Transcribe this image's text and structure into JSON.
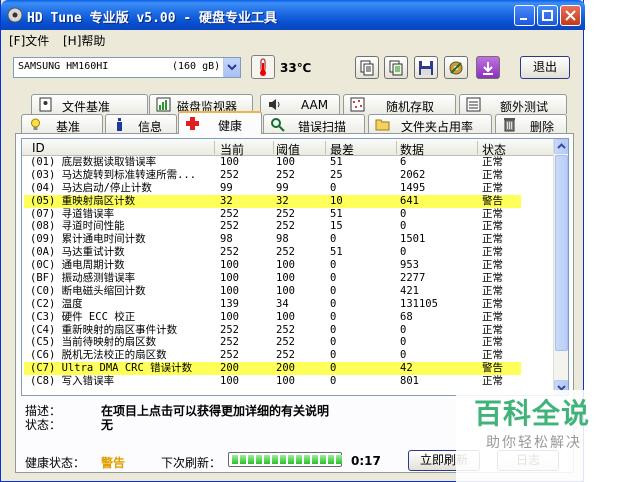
{
  "window": {
    "title": "HD Tune 专业版 v5.00 - 硬盘专业工具"
  },
  "menu": {
    "file": "[F]文件",
    "help": "[H]帮助"
  },
  "toolbar": {
    "drive": "SAMSUNG HM160HI",
    "capacity": "(160 gB)",
    "temperature": "33℃",
    "exit_label": "退出"
  },
  "tabs_top": [
    "文件基准",
    "磁盘监视器",
    "AAM",
    "随机存取",
    "额外测试"
  ],
  "tabs_bottom": [
    "基准",
    "信息",
    "健康",
    "错误扫描",
    "文件夹占用率",
    "删除"
  ],
  "active_tab": "健康",
  "table": {
    "headers": [
      "ID",
      "当前",
      "阈值",
      "最差",
      "数据",
      "状态"
    ],
    "rows": [
      {
        "id": "(01) 底层数据读取错误率",
        "cur": "100",
        "thr": "100",
        "worst": "51",
        "data": "6",
        "status": "正常",
        "warn": false
      },
      {
        "id": "(03) 马达旋转到标准转速所需...",
        "cur": "252",
        "thr": "252",
        "worst": "25",
        "data": "2062",
        "status": "正常",
        "warn": false
      },
      {
        "id": "(04) 马达启动/停止计数",
        "cur": "99",
        "thr": "99",
        "worst": "0",
        "data": "1495",
        "status": "正常",
        "warn": false
      },
      {
        "id": "(05) 重映射扇区计数",
        "cur": "32",
        "thr": "32",
        "worst": "10",
        "data": "641",
        "status": "警告",
        "warn": true
      },
      {
        "id": "(07) 寻道错误率",
        "cur": "252",
        "thr": "252",
        "worst": "51",
        "data": "0",
        "status": "正常",
        "warn": false
      },
      {
        "id": "(08) 寻道时间性能",
        "cur": "252",
        "thr": "252",
        "worst": "15",
        "data": "0",
        "status": "正常",
        "warn": false
      },
      {
        "id": "(09) 累计通电时间计数",
        "cur": "98",
        "thr": "98",
        "worst": "0",
        "data": "1501",
        "status": "正常",
        "warn": false
      },
      {
        "id": "(0A) 马达重试计数",
        "cur": "252",
        "thr": "252",
        "worst": "51",
        "data": "0",
        "status": "正常",
        "warn": false
      },
      {
        "id": "(0C) 通电周期计数",
        "cur": "100",
        "thr": "100",
        "worst": "0",
        "data": "953",
        "status": "正常",
        "warn": false
      },
      {
        "id": "(BF) 振动感测错误率",
        "cur": "100",
        "thr": "100",
        "worst": "0",
        "data": "2277",
        "status": "正常",
        "warn": false
      },
      {
        "id": "(C0) 断电磁头缩回计数",
        "cur": "100",
        "thr": "100",
        "worst": "0",
        "data": "421",
        "status": "正常",
        "warn": false
      },
      {
        "id": "(C2) 温度",
        "cur": "139",
        "thr": "34",
        "worst": "0",
        "data": "131105",
        "status": "正常",
        "warn": false
      },
      {
        "id": "(C3) 硬件 ECC 校正",
        "cur": "100",
        "thr": "100",
        "worst": "0",
        "data": "68",
        "status": "正常",
        "warn": false
      },
      {
        "id": "(C4) 重新映射的扇区事件计数",
        "cur": "252",
        "thr": "252",
        "worst": "0",
        "data": "0",
        "status": "正常",
        "warn": false
      },
      {
        "id": "(C5) 当前待映射的扇区数",
        "cur": "252",
        "thr": "252",
        "worst": "0",
        "data": "0",
        "status": "正常",
        "warn": false
      },
      {
        "id": "(C6) 脱机无法校正的扇区数",
        "cur": "252",
        "thr": "252",
        "worst": "0",
        "data": "0",
        "status": "正常",
        "warn": false
      },
      {
        "id": "(C7) Ultra DMA CRC 错误计数",
        "cur": "200",
        "thr": "200",
        "worst": "0",
        "data": "42",
        "status": "警告",
        "warn": true
      },
      {
        "id": "(C8) 写入错误率",
        "cur": "100",
        "thr": "100",
        "worst": "0",
        "data": "801",
        "status": "正常",
        "warn": false
      }
    ]
  },
  "description": {
    "label": "描述：",
    "text": "在项目上点击可以获得更加详细的有关说明",
    "status_label": "状态：",
    "status_text": "无"
  },
  "status_bar": {
    "health_label": "健康状态：",
    "health_value": "警告",
    "next_refresh_label": "下次刷新：",
    "timer": "0:17",
    "refresh_button": "立即刷新",
    "log_button": "日志"
  },
  "watermark": {
    "main": "百科全说",
    "sub": "助你轻松解决"
  }
}
